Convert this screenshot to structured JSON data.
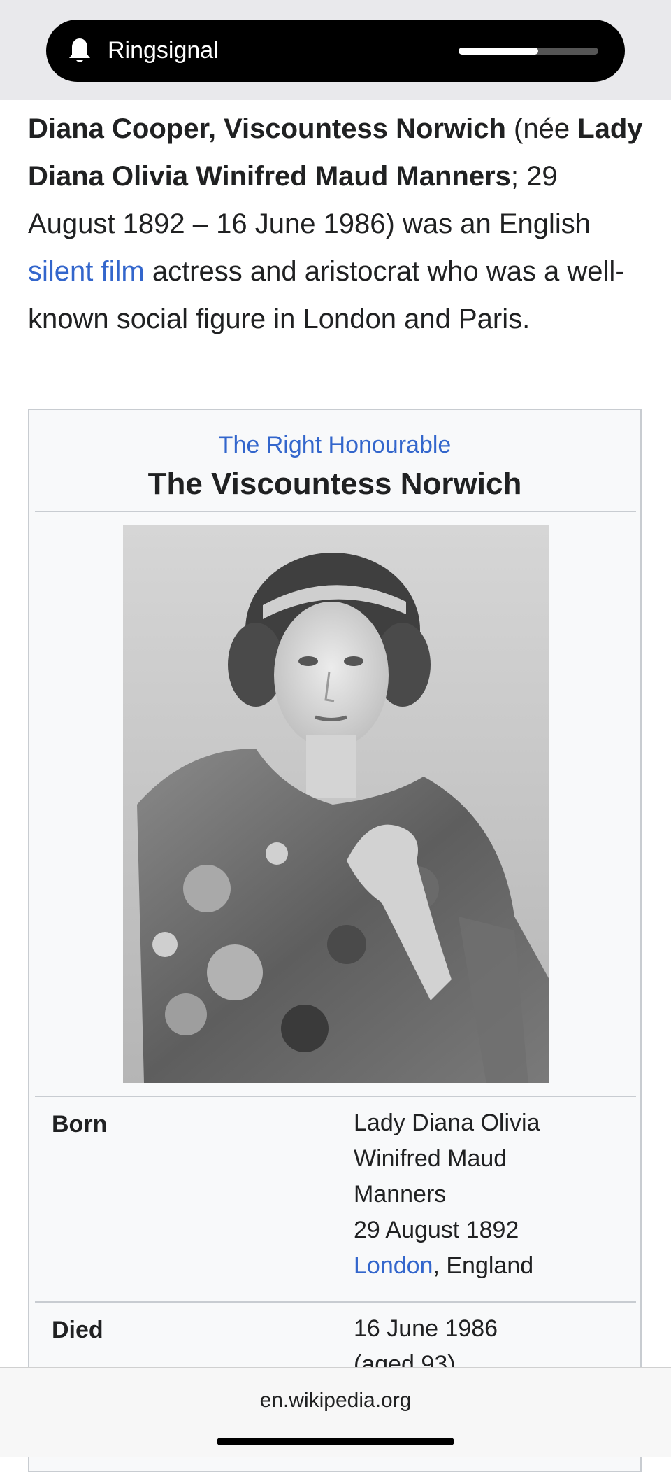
{
  "notification": {
    "title": "Ringsignal",
    "icon": "bell-icon",
    "volume_level_percent": 57
  },
  "article": {
    "intro": {
      "name_bold": "Diana Cooper, Viscountess Norwich",
      "nee_prefix": " (née ",
      "birth_name_bold": "Lady Diana Olivia Winifred Maud Manners",
      "dates_text": "; 29 August 1892 – 16 June 1986) was an English ",
      "link_text": "silent film",
      "closing_text": " actress and aristocrat who was a well-known social figure in London and Paris."
    },
    "infobox": {
      "honorific": "The Right Honourable",
      "title": "The Viscountess Norwich",
      "born_label": "Born",
      "born_lines": [
        "Lady Diana Olivia",
        "Winifred Maud",
        "Manners",
        "29 August 1892"
      ],
      "born_place_link": "London",
      "born_place_rest": ", England",
      "died_label": "Died",
      "died_date": "16 June 1986",
      "died_age": "(aged 93)"
    }
  },
  "browser": {
    "url": "en.wikipedia.org"
  },
  "colors": {
    "link": "#3366cc",
    "infobox_bg": "#f8f9fa",
    "border": "#c8ccd1"
  }
}
